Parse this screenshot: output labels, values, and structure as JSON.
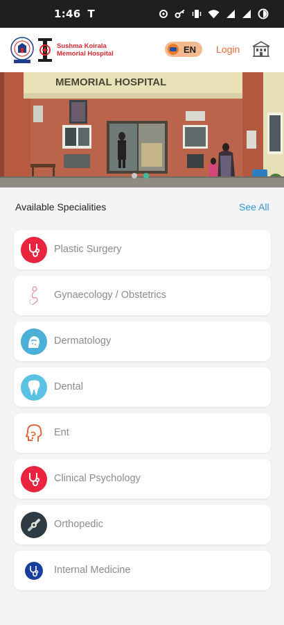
{
  "status_bar": {
    "time": "1:46",
    "carrier_glyph": "T"
  },
  "header": {
    "hospital_name_line1": "Sushma Koirala",
    "hospital_name_line2": "Memorial Hospital",
    "language_label": "EN",
    "login_label": "Login",
    "accent_color": "#e2673a"
  },
  "banner": {
    "sign_text": "MEMORIAL HOSPITAL",
    "slide_count": 2,
    "active_slide": 2
  },
  "specialities": {
    "title": "Available Specialities",
    "see_all_label": "See All",
    "items": [
      {
        "label": "Plastic Surgery",
        "icon": "stethoscope-icon"
      },
      {
        "label": "Gynaecology / Obstetrics",
        "icon": "pregnancy-icon"
      },
      {
        "label": "Dermatology",
        "icon": "skin-icon"
      },
      {
        "label": "Dental",
        "icon": "tooth-icon"
      },
      {
        "label": "Ent",
        "icon": "ear-nose-throat-icon"
      },
      {
        "label": "Clinical Psychology",
        "icon": "stethoscope-icon"
      },
      {
        "label": "Orthopedic",
        "icon": "bone-joint-icon"
      },
      {
        "label": "Internal Medicine",
        "icon": "stethoscope-icon"
      }
    ]
  }
}
